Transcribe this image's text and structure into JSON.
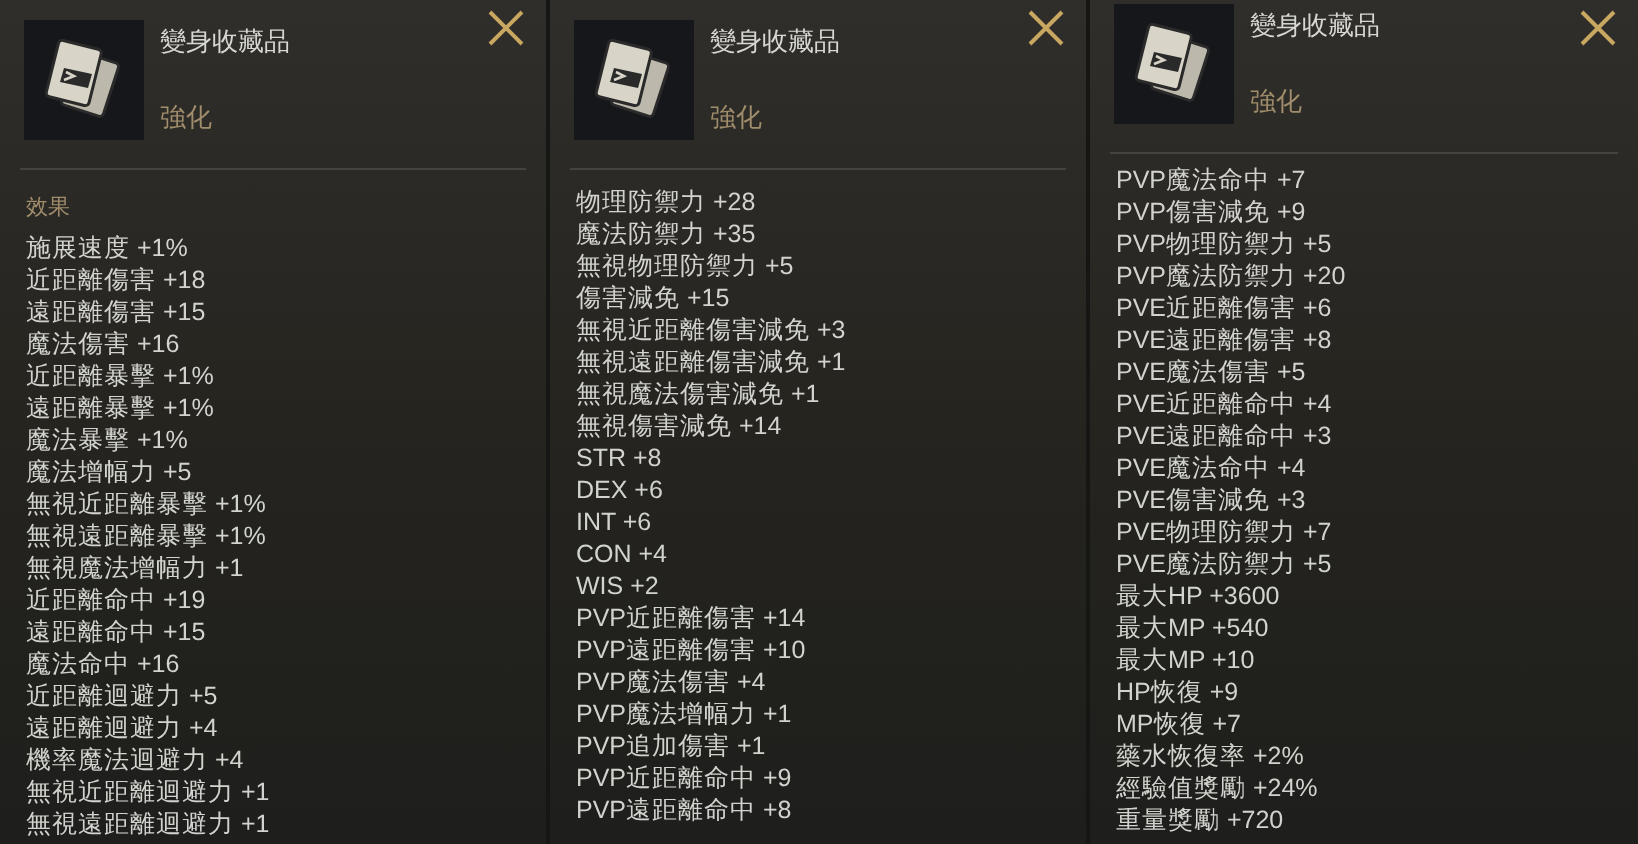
{
  "panels": [
    {
      "title": "變身收藏品",
      "subtitle": "強化",
      "section": "效果",
      "stats": [
        "施展速度 +1%",
        "近距離傷害 +18",
        "遠距離傷害 +15",
        "魔法傷害 +16",
        "近距離暴擊 +1%",
        "遠距離暴擊 +1%",
        "魔法暴擊 +1%",
        "魔法增幅力 +5",
        "無視近距離暴擊 +1%",
        "無視遠距離暴擊 +1%",
        "無視魔法增幅力 +1",
        "近距離命中 +19",
        "遠距離命中 +15",
        "魔法命中 +16",
        "近距離迴避力 +5",
        "遠距離迴避力 +4",
        "機率魔法迴避力 +4",
        "無視近距離迴避力 +1",
        "無視遠距離迴避力 +1"
      ]
    },
    {
      "title": "變身收藏品",
      "subtitle": "強化",
      "stats": [
        "物理防禦力 +28",
        "魔法防禦力 +35",
        "無視物理防禦力 +5",
        "傷害減免 +15",
        "無視近距離傷害減免 +3",
        "無視遠距離傷害減免 +1",
        "無視魔法傷害減免 +1",
        "無視傷害減免 +14",
        "STR +8",
        "DEX +6",
        "INT +6",
        "CON +4",
        "WIS +2",
        "PVP近距離傷害 +14",
        "PVP遠距離傷害 +10",
        "PVP魔法傷害 +4",
        "PVP魔法增幅力 +1",
        "PVP追加傷害 +1",
        "PVP近距離命中 +9",
        "PVP遠距離命中 +8"
      ]
    },
    {
      "title": "變身收藏品",
      "subtitle": "強化",
      "stats": [
        "PVP魔法命中 +7",
        "PVP傷害減免 +9",
        "PVP物理防禦力 +5",
        "PVP魔法防禦力 +20",
        "PVE近距離傷害 +6",
        "PVE遠距離傷害 +8",
        "PVE魔法傷害 +5",
        "PVE近距離命中 +4",
        "PVE遠距離命中 +3",
        "PVE魔法命中 +4",
        "PVE傷害減免 +3",
        "PVE物理防禦力 +7",
        "PVE魔法防禦力 +5",
        "最大HP +3600",
        "最大MP +540",
        "最大MP +10",
        "HP恢復 +9",
        "MP恢復 +7",
        "藥水恢復率 +2%",
        "經驗值獎勵 +24%",
        "重量獎勵 +720"
      ]
    }
  ]
}
